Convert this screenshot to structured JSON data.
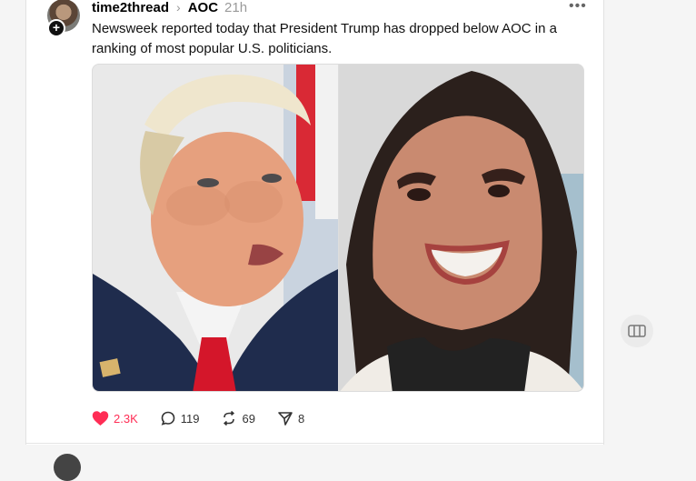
{
  "post": {
    "username": "time2thread",
    "topic": "AOC",
    "time": "21h",
    "text": "Newsweek reported today that President Trump has dropped below AOC in a ranking of most popular U.S. politicians.",
    "likes": "2.3K",
    "replies": "119",
    "reposts": "69",
    "shares": "8"
  },
  "icons": {
    "more": "more-icon",
    "follow": "plus-icon",
    "like": "heart-icon",
    "reply": "comment-icon",
    "repost": "repost-icon",
    "share": "send-icon",
    "side": "columns-icon"
  },
  "colors": {
    "like": "#ff2d55",
    "muted": "#9a9a9a"
  }
}
